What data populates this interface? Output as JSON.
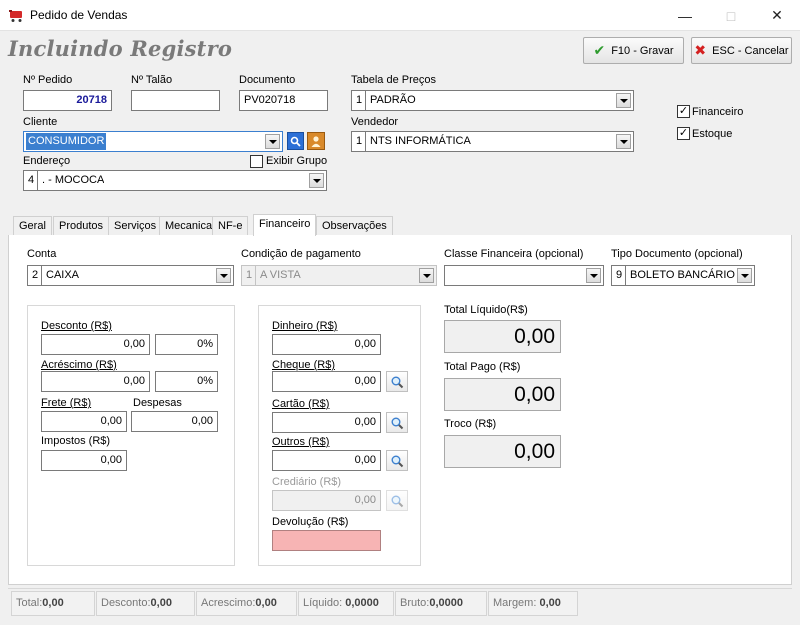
{
  "window": {
    "title": "Pedido de Vendas"
  },
  "header": {
    "heading": "Incluindo Registro",
    "save_label": "F10 - Gravar",
    "cancel_label": "ESC - Cancelar"
  },
  "form": {
    "pedido_label": "Nº Pedido",
    "pedido_value": "20718",
    "talao_label": "Nº Talão",
    "talao_value": "",
    "documento_label": "Documento",
    "documento_value": "PV020718",
    "tabela_label": "Tabela de Preços",
    "tabela_code": "1",
    "tabela_value": "PADRÃO",
    "cliente_label": "Cliente",
    "cliente_value": "CONSUMIDOR",
    "vendedor_label": "Vendedor",
    "vendedor_code": "1",
    "vendedor_value": "NTS INFORMÁTICA",
    "endereco_label": "Endereço",
    "endereco_code": "4",
    "endereco_value": ". - MOCOCA",
    "exibir_grupo_label": "Exibir Grupo",
    "financeiro_label": "Financeiro",
    "estoque_label": "Estoque"
  },
  "tabs": [
    "Geral",
    "Produtos",
    "Serviços",
    "Mecanica",
    "NF-e",
    "Financeiro",
    "Observações"
  ],
  "financeiro": {
    "conta_label": "Conta",
    "conta_code": "2",
    "conta_value": "CAIXA",
    "condicao_label": "Condição de pagamento",
    "condicao_code": "1",
    "condicao_value": "A VISTA",
    "classe_label": "Classe Financeira (opcional)",
    "classe_value": "",
    "tipo_doc_label": "Tipo Documento (opcional)",
    "tipo_doc_code": "9",
    "tipo_doc_value": "BOLETO BANCÁRIO",
    "desconto_label": "Desconto (R$)",
    "desconto_value": "0,00",
    "desconto_pct": "0%",
    "acrescimo_label": "Acréscimo (R$)",
    "acrescimo_value": "0,00",
    "acrescimo_pct": "0%",
    "frete_label": "Frete (R$)",
    "frete_value": "0,00",
    "despesas_label": "Despesas",
    "despesas_value": "0,00",
    "impostos_label": "Impostos (R$)",
    "impostos_value": "0,00",
    "dinheiro_label": "Dinheiro (R$)",
    "dinheiro_value": "0,00",
    "cheque_label": "Cheque (R$)",
    "cheque_value": "0,00",
    "cartao_label": "Cartão (R$)",
    "cartao_value": "0,00",
    "outros_label": "Outros (R$)",
    "outros_value": "0,00",
    "crediario_label": "Crediário (R$)",
    "crediario_value": "0,00",
    "devolucao_label": "Devolução (R$)",
    "devolucao_value": "",
    "total_liquido_label": "Total Líquido(R$)",
    "total_liquido_value": "0,00",
    "total_pago_label": "Total Pago (R$)",
    "total_pago_value": "0,00",
    "troco_label": "Troco (R$)",
    "troco_value": "0,00"
  },
  "status": {
    "total_label": "Total:",
    "total_value": "0,00",
    "desconto_label": "Desconto:",
    "desconto_value": "0,00",
    "acrescimo_label": "Acrescimo:",
    "acrescimo_value": "0,00",
    "liquido_label": "Líquido:",
    "liquido_value": "0,0000",
    "bruto_label": "Bruto:",
    "bruto_value": "0,0000",
    "margem_label": "Margem:",
    "margem_value": "0,00"
  },
  "colors": {
    "accent": "#3b7fcf",
    "pedido_text": "#1a1a9a",
    "devolucao_bg": "#f7b4b4",
    "heading": "#7a7a7a"
  },
  "icons": [
    "cart-icon",
    "minimize-icon",
    "maximize-icon",
    "close-icon",
    "check-icon",
    "cancel-x-icon",
    "search-icon",
    "person-icon",
    "magnifier-icon"
  ]
}
